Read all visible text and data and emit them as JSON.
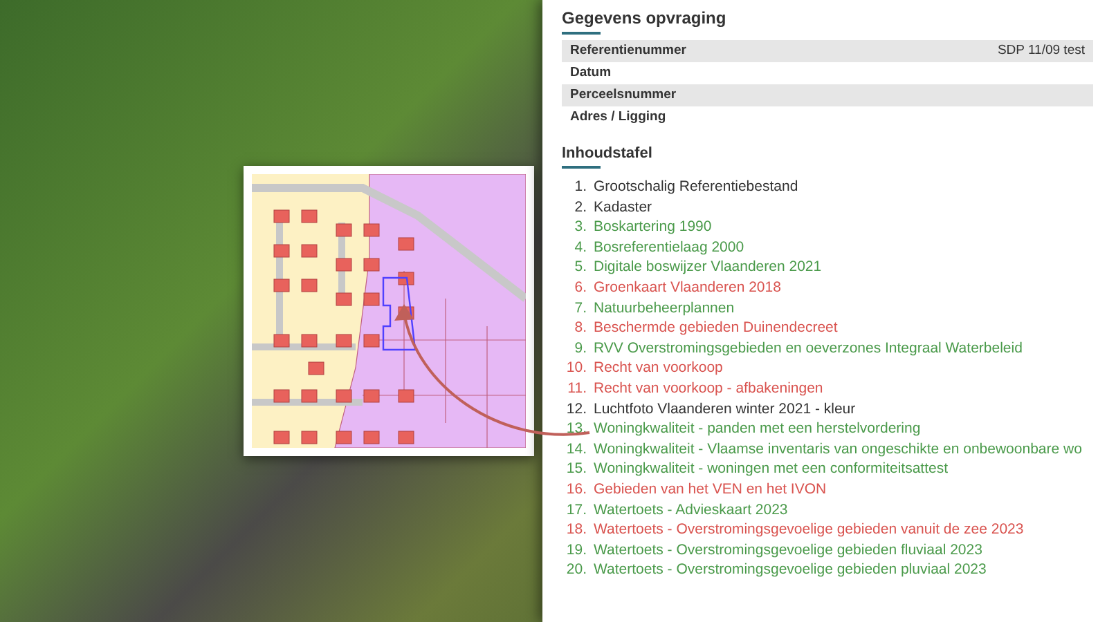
{
  "document": {
    "section_title": "Gegevens opvraging",
    "fields": [
      {
        "label": "Referentienummer",
        "value": "SDP 11/09 test"
      },
      {
        "label": "Datum"
      },
      {
        "label": "Perceelsnummer"
      },
      {
        "label": "Adres / Ligging"
      }
    ],
    "toc": {
      "title": "Inhoudstafel",
      "items": [
        {
          "number": "1.",
          "text": "Grootschalig Referentiebestand",
          "color": "#333333"
        },
        {
          "number": "2.",
          "text": "Kadaster",
          "color": "#333333"
        },
        {
          "number": "3.",
          "text": "Boskartering 1990",
          "color": "#4a9a4a"
        },
        {
          "number": "4.",
          "text": "Bosreferentielaag 2000",
          "color": "#4a9a4a"
        },
        {
          "number": "5.",
          "text": "Digitale boswijzer Vlaanderen 2021",
          "color": "#4a9a4a"
        },
        {
          "number": "6.",
          "text": "Groenkaart Vlaanderen 2018",
          "color": "#d9534f"
        },
        {
          "number": "7.",
          "text": "Natuurbeheerplannen",
          "color": "#4a9a4a"
        },
        {
          "number": "8.",
          "text": "Beschermde gebieden Duinendecreet",
          "color": "#d9534f"
        },
        {
          "number": "9.",
          "text": "RVV Overstromingsgebieden en oeverzones Integraal Waterbeleid",
          "color": "#4a9a4a"
        },
        {
          "number": "10.",
          "text": "Recht van voorkoop",
          "color": "#d9534f"
        },
        {
          "number": "11.",
          "text": "Recht van voorkoop - afbakeningen",
          "color": "#d9534f"
        },
        {
          "number": "12.",
          "text": "Luchtfoto Vlaanderen winter 2021 - kleur",
          "color": "#333333"
        },
        {
          "number": "13.",
          "text": "Woningkwaliteit - panden met een herstelvordering",
          "color": "#4a9a4a"
        },
        {
          "number": "14.",
          "text": "Woningkwaliteit - Vlaamse inventaris van ongeschikte en onbewoonbare wo",
          "color": "#4a9a4a"
        },
        {
          "number": "15.",
          "text": "Woningkwaliteit - woningen met een conformiteitsattest",
          "color": "#4a9a4a"
        },
        {
          "number": "16.",
          "text": "Gebieden van het VEN en het IVON",
          "color": "#d9534f"
        },
        {
          "number": "17.",
          "text": "Watertoets - Advieskaart 2023",
          "color": "#4a9a4a"
        },
        {
          "number": "18.",
          "text": "Watertoets - Overstromingsgevoelige gebieden vanuit de zee 2023",
          "color": "#d9534f"
        },
        {
          "number": "19.",
          "text": "Watertoets - Overstromingsgevoelige gebieden fluviaal 2023",
          "color": "#4a9a4a"
        },
        {
          "number": "20.",
          "text": "Watertoets - Overstromingsgevoelige gebieden pluviaal 2023",
          "color": "#4a9a4a"
        }
      ]
    }
  }
}
